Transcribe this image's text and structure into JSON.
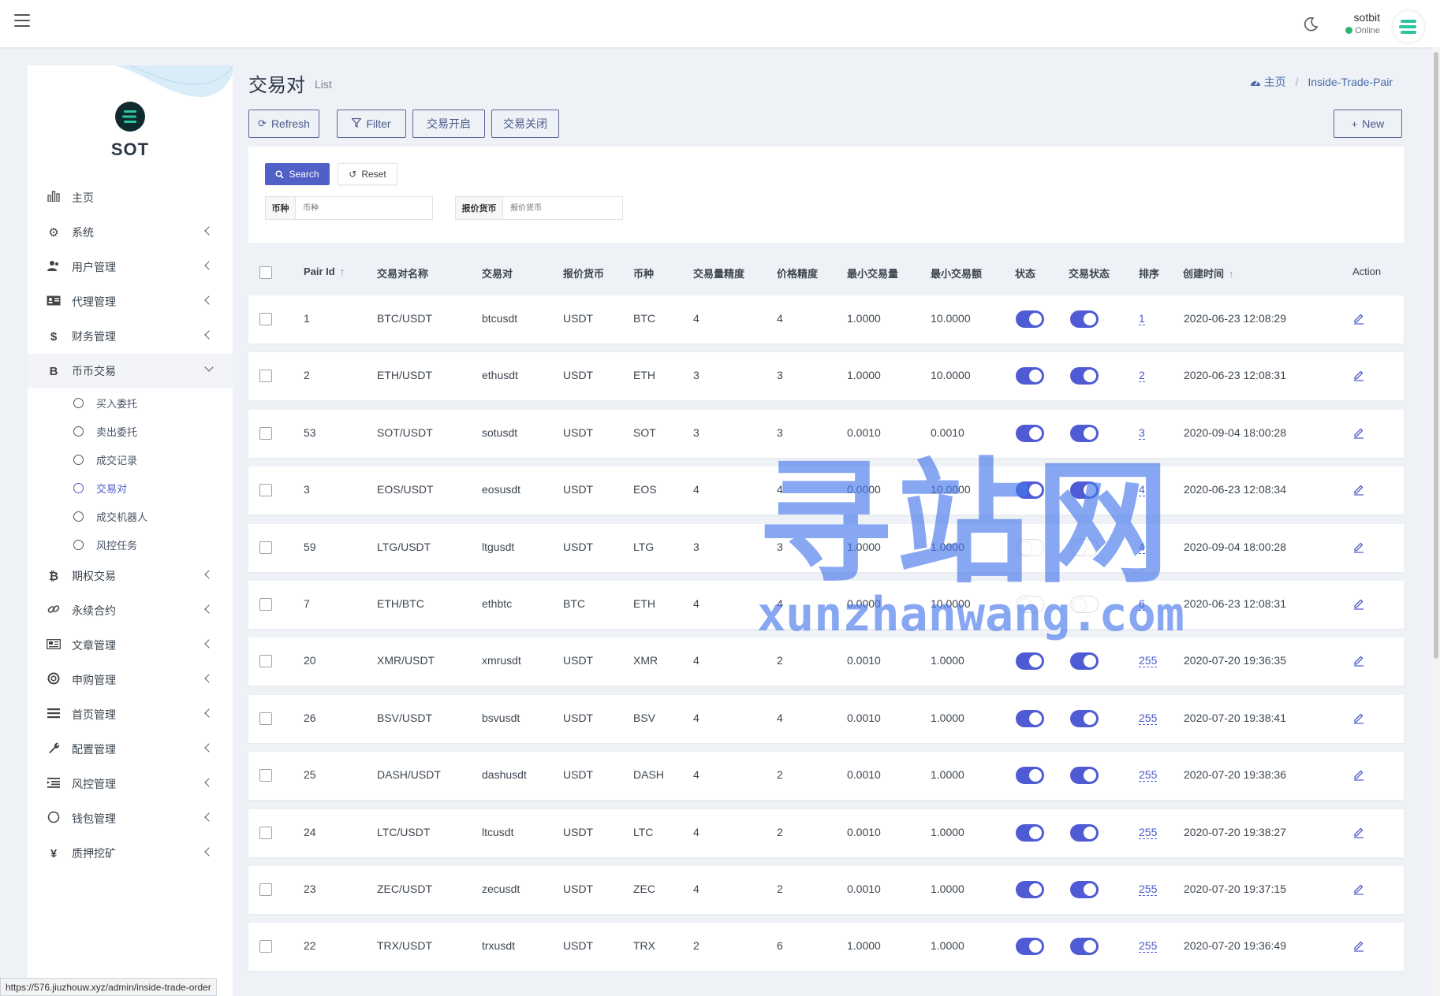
{
  "topbar": {
    "user_name": "sotbit",
    "user_status": "Online"
  },
  "brand": {
    "name": "SOT"
  },
  "sidebar": {
    "items": [
      {
        "label": "主页",
        "icon": "bar-chart-icon",
        "has_chevron": false
      },
      {
        "label": "系统",
        "icon": "gear-icon",
        "has_chevron": true
      },
      {
        "label": "用户管理",
        "icon": "users-icon",
        "has_chevron": true
      },
      {
        "label": "代理管理",
        "icon": "id-card-icon",
        "has_chevron": true
      },
      {
        "label": "财务管理",
        "icon": "dollar-icon",
        "has_chevron": true
      },
      {
        "label": "币币交易",
        "icon": "bitcoin-b-icon",
        "has_chevron": true,
        "open": true
      },
      {
        "label": "期权交易",
        "icon": "bitcoin-icon",
        "has_chevron": true
      },
      {
        "label": "永续合约",
        "icon": "link-icon",
        "has_chevron": true
      },
      {
        "label": "文章管理",
        "icon": "newspaper-icon",
        "has_chevron": true
      },
      {
        "label": "申购管理",
        "icon": "lifebuoy-icon",
        "has_chevron": true
      },
      {
        "label": "首页管理",
        "icon": "list-icon",
        "has_chevron": true
      },
      {
        "label": "配置管理",
        "icon": "wrench-icon",
        "has_chevron": true
      },
      {
        "label": "风控管理",
        "icon": "indent-list-icon",
        "has_chevron": true
      },
      {
        "label": "钱包管理",
        "icon": "circle-icon",
        "has_chevron": true
      },
      {
        "label": "质押挖矿",
        "icon": "yen-icon",
        "has_chevron": true
      }
    ],
    "subitems": [
      {
        "label": "买入委托",
        "active": false
      },
      {
        "label": "卖出委托",
        "active": false
      },
      {
        "label": "成交记录",
        "active": false
      },
      {
        "label": "交易对",
        "active": true
      },
      {
        "label": "成交机器人",
        "active": false
      },
      {
        "label": "风控任务",
        "active": false
      }
    ]
  },
  "header": {
    "title": "交易对",
    "subtitle": "List",
    "breadcrumb_home": "主页",
    "breadcrumb_current": "Inside-Trade-Pair"
  },
  "toolbar": {
    "refresh": "Refresh",
    "filter": "Filter",
    "open_trading": "交易开启",
    "close_trading": "交易关闭",
    "new": "New"
  },
  "filter": {
    "search": "Search",
    "reset": "Reset",
    "fields": [
      {
        "label": "币种",
        "placeholder": "币种",
        "value": ""
      },
      {
        "label": "报价货币",
        "placeholder": "报价货币",
        "value": ""
      }
    ]
  },
  "table": {
    "columns": [
      "Pair Id",
      "交易对名称",
      "交易对",
      "报价货币",
      "币种",
      "交易量精度",
      "价格精度",
      "最小交易量",
      "最小交易额",
      "状态",
      "交易状态",
      "排序",
      "创建时间",
      "Action"
    ],
    "sortable": {
      "Pair Id": "↑",
      "创建时间": "↑"
    },
    "rows": [
      {
        "id": "1",
        "name": "BTC/USDT",
        "pair": "btcusdt",
        "quote": "USDT",
        "coin": "BTC",
        "vol_prec": "4",
        "price_prec": "4",
        "min_vol": "1.0000",
        "min_amt": "10.0000",
        "status": true,
        "trade_status": true,
        "sort": "1",
        "created": "2020-06-23 12:08:29"
      },
      {
        "id": "2",
        "name": "ETH/USDT",
        "pair": "ethusdt",
        "quote": "USDT",
        "coin": "ETH",
        "vol_prec": "3",
        "price_prec": "3",
        "min_vol": "1.0000",
        "min_amt": "10.0000",
        "status": true,
        "trade_status": true,
        "sort": "2",
        "created": "2020-06-23 12:08:31"
      },
      {
        "id": "53",
        "name": "SOT/USDT",
        "pair": "sotusdt",
        "quote": "USDT",
        "coin": "SOT",
        "vol_prec": "3",
        "price_prec": "3",
        "min_vol": "0.0010",
        "min_amt": "0.0010",
        "status": true,
        "trade_status": true,
        "sort": "3",
        "created": "2020-09-04 18:00:28"
      },
      {
        "id": "3",
        "name": "EOS/USDT",
        "pair": "eosusdt",
        "quote": "USDT",
        "coin": "EOS",
        "vol_prec": "4",
        "price_prec": "4",
        "min_vol": "0.0000",
        "min_amt": "10.0000",
        "status": true,
        "trade_status": true,
        "sort": "4",
        "created": "2020-06-23 12:08:34"
      },
      {
        "id": "59",
        "name": "LTG/USDT",
        "pair": "ltgusdt",
        "quote": "USDT",
        "coin": "LTG",
        "vol_prec": "3",
        "price_prec": "3",
        "min_vol": "1.0000",
        "min_amt": "1.0000",
        "status": false,
        "trade_status": false,
        "sort": "4",
        "created": "2020-09-04 18:00:28"
      },
      {
        "id": "7",
        "name": "ETH/BTC",
        "pair": "ethbtc",
        "quote": "BTC",
        "coin": "ETH",
        "vol_prec": "4",
        "price_prec": "4",
        "min_vol": "0.0000",
        "min_amt": "10.0000",
        "status": false,
        "trade_status": false,
        "sort": "6",
        "created": "2020-06-23 12:08:31"
      },
      {
        "id": "20",
        "name": "XMR/USDT",
        "pair": "xmrusdt",
        "quote": "USDT",
        "coin": "XMR",
        "vol_prec": "4",
        "price_prec": "2",
        "min_vol": "0.0010",
        "min_amt": "1.0000",
        "status": true,
        "trade_status": true,
        "sort": "255",
        "created": "2020-07-20 19:36:35"
      },
      {
        "id": "26",
        "name": "BSV/USDT",
        "pair": "bsvusdt",
        "quote": "USDT",
        "coin": "BSV",
        "vol_prec": "4",
        "price_prec": "4",
        "min_vol": "0.0010",
        "min_amt": "1.0000",
        "status": true,
        "trade_status": true,
        "sort": "255",
        "created": "2020-07-20 19:38:41"
      },
      {
        "id": "25",
        "name": "DASH/USDT",
        "pair": "dashusdt",
        "quote": "USDT",
        "coin": "DASH",
        "vol_prec": "4",
        "price_prec": "2",
        "min_vol": "0.0010",
        "min_amt": "1.0000",
        "status": true,
        "trade_status": true,
        "sort": "255",
        "created": "2020-07-20 19:38:36"
      },
      {
        "id": "24",
        "name": "LTC/USDT",
        "pair": "ltcusdt",
        "quote": "USDT",
        "coin": "LTC",
        "vol_prec": "4",
        "price_prec": "2",
        "min_vol": "0.0010",
        "min_amt": "1.0000",
        "status": true,
        "trade_status": true,
        "sort": "255",
        "created": "2020-07-20 19:38:27"
      },
      {
        "id": "23",
        "name": "ZEC/USDT",
        "pair": "zecusdt",
        "quote": "USDT",
        "coin": "ZEC",
        "vol_prec": "4",
        "price_prec": "2",
        "min_vol": "0.0010",
        "min_amt": "1.0000",
        "status": true,
        "trade_status": true,
        "sort": "255",
        "created": "2020-07-20 19:37:15"
      },
      {
        "id": "22",
        "name": "TRX/USDT",
        "pair": "trxusdt",
        "quote": "USDT",
        "coin": "TRX",
        "vol_prec": "2",
        "price_prec": "6",
        "min_vol": "1.0000",
        "min_amt": "1.0000",
        "status": true,
        "trade_status": true,
        "sort": "255",
        "created": "2020-07-20 19:36:49"
      }
    ]
  },
  "status_bar": {
    "url": "https://576.jiuzhouw.xyz/admin/inside-trade-order"
  },
  "watermark": {
    "cn": "寻站网",
    "en": "xunzhanwang.com"
  },
  "colors": {
    "accent": "#4f5bd5",
    "online": "#2fb36a",
    "brand_teal": "#2ec4a0"
  }
}
